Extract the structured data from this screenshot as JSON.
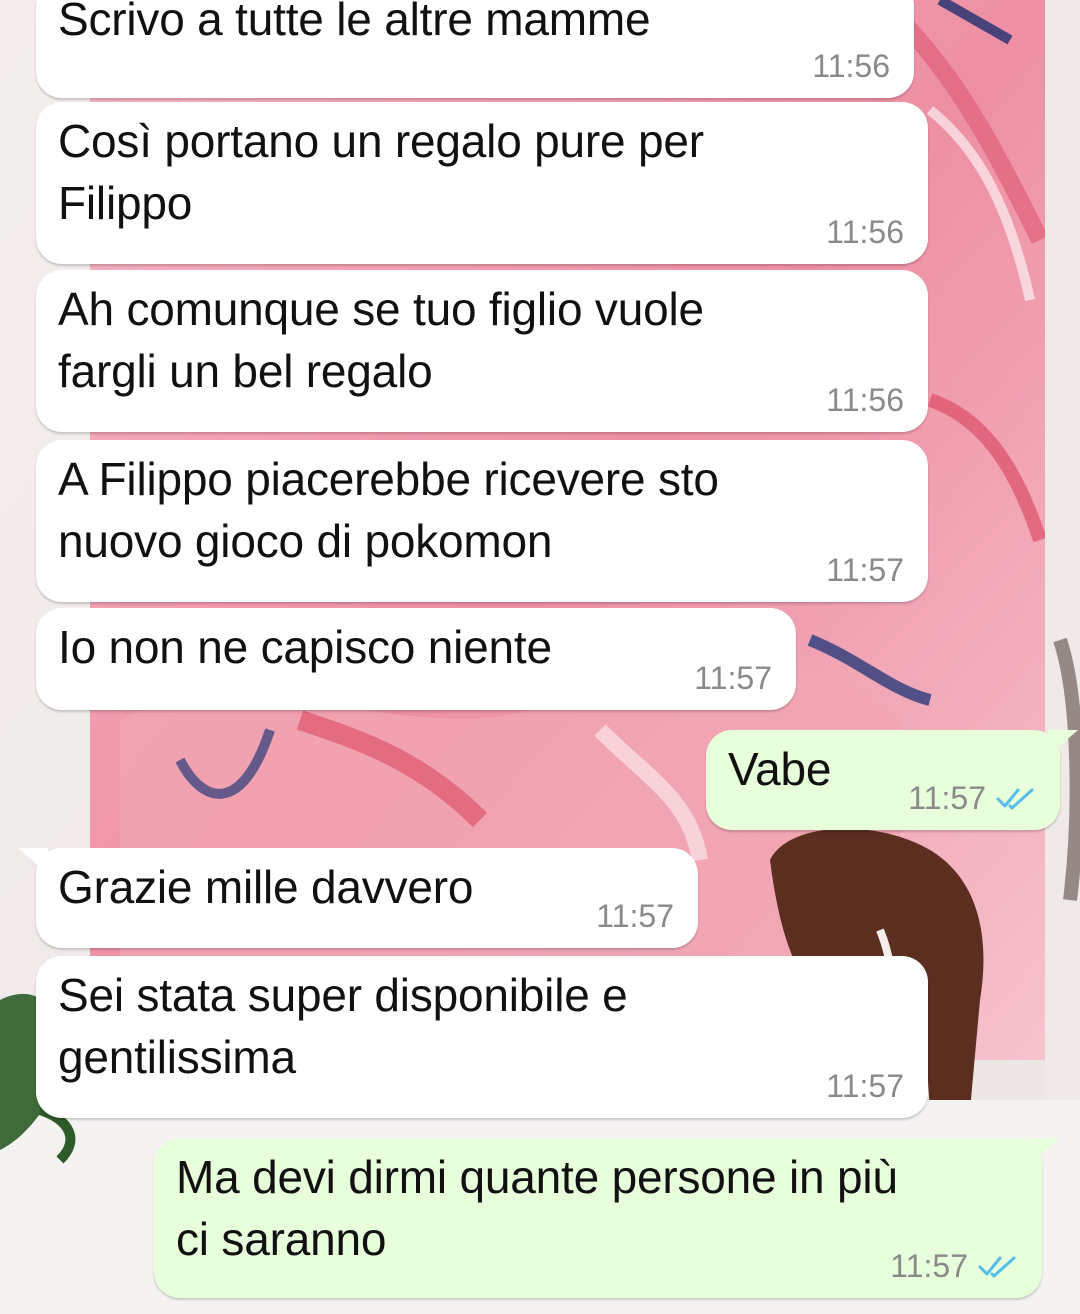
{
  "theme": {
    "incoming_bubble": "#ffffff",
    "outgoing_bubble": "#e7ffdb",
    "time_color": "#8a8a8a",
    "read_ticks_color": "#53bdeb"
  },
  "messages": [
    {
      "direction": "in",
      "text": "Scrivo a tutte le altre mamme",
      "time": "11:56"
    },
    {
      "direction": "in",
      "text": "Così portano un regalo pure per\nFilippo",
      "time": "11:56"
    },
    {
      "direction": "in",
      "text": "Ah comunque se tuo figlio vuole\nfargli un bel regalo",
      "time": "11:56"
    },
    {
      "direction": "in",
      "text": "A Filippo piacerebbe ricevere sto\nnuovo gioco di pokomon",
      "time": "11:57"
    },
    {
      "direction": "in",
      "text": "Io non ne capisco niente",
      "time": "11:57"
    },
    {
      "direction": "out",
      "text": "Vabe",
      "time": "11:57",
      "status": "read",
      "status_icon": "double-check-icon"
    },
    {
      "direction": "in",
      "text": "Grazie mille davvero",
      "time": "11:57"
    },
    {
      "direction": "in",
      "text": "Sei stata super disponibile e\ngentilissima",
      "time": "11:57"
    },
    {
      "direction": "out",
      "text": "Ma devi dirmi quante persone in più\nci saranno",
      "time": "11:57",
      "status": "read",
      "status_icon": "double-check-icon"
    }
  ]
}
